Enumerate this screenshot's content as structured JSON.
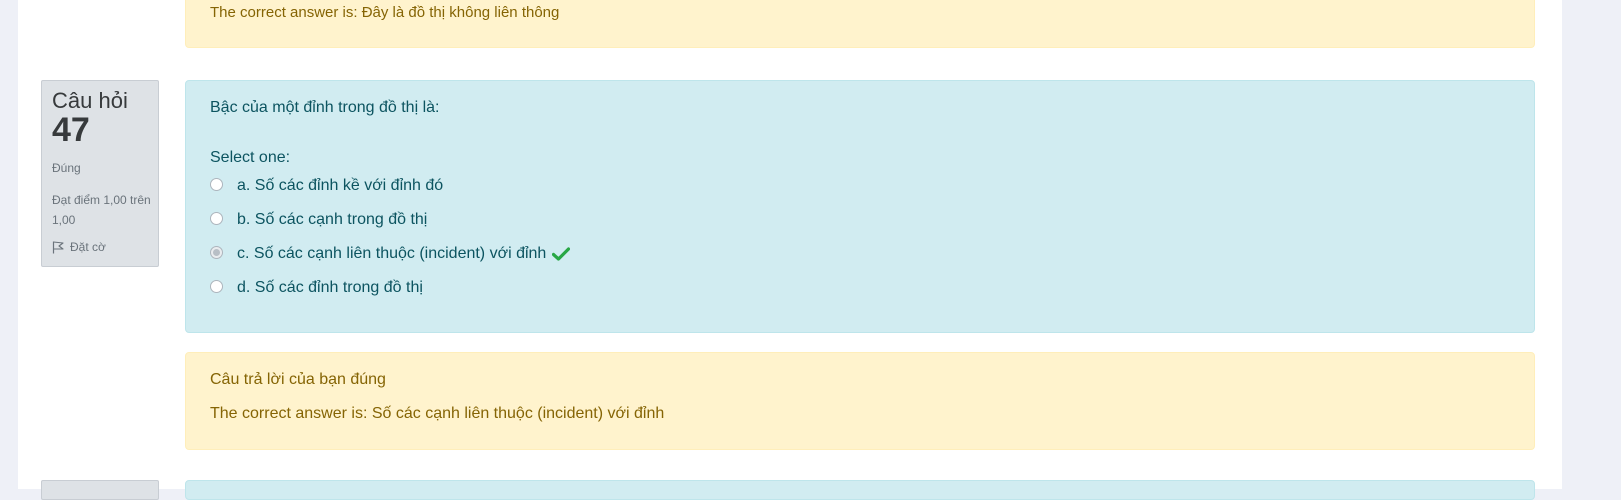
{
  "prev_question": {
    "correct_answer_text": "The correct answer is: Đây là đồ thị không liên thông"
  },
  "question": {
    "label": "Câu hỏi",
    "number": "47",
    "state": "Đúng",
    "grade": "Đạt điểm 1,00 trên 1,00",
    "flag_label": "Đặt cờ",
    "text": "Bậc của một đỉnh trong đồ thị là:",
    "prompt": "Select one:",
    "options": [
      {
        "label": "a. Số các đỉnh kề với đỉnh đó",
        "checked": false
      },
      {
        "label": "b. Số các cạnh trong đồ thị",
        "checked": false
      },
      {
        "label": "c. Số các cạnh liên thuộc (incident) với đỉnh",
        "checked": true,
        "correct_mark": "check-icon"
      },
      {
        "label": "d. Số các đỉnh trong đồ thị",
        "checked": false
      }
    ],
    "feedback": {
      "result": "Câu trả lời của bạn đúng",
      "correct_answer": "The correct answer is: Số các cạnh liên thuộc (incident) với đỉnh"
    }
  },
  "colors": {
    "info_bg": "#d1ecf1",
    "warning_bg": "#fff3cd",
    "check": "#28a745"
  }
}
